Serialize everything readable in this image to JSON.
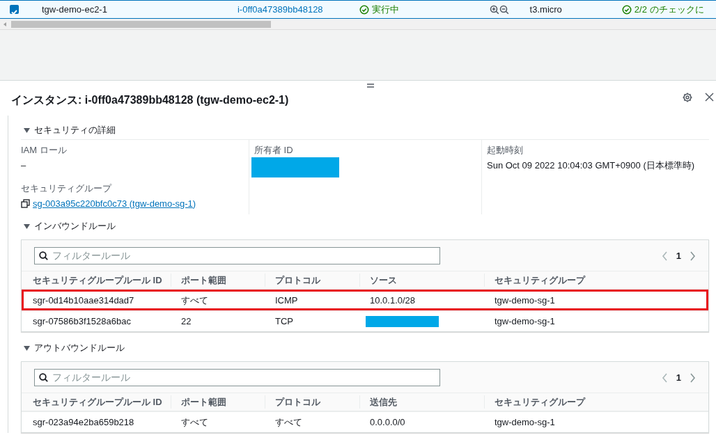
{
  "instance_row": {
    "checked": true,
    "name": "tgw-demo-ec2-1",
    "instance_id": "i-0ff0a47389bb48128",
    "state": "実行中",
    "type": "t3.micro",
    "status_check": "2/2 のチェックに"
  },
  "panel": {
    "title": "インスタンス: i-0ff0a47389bb48128 (tgw-demo-ec2-1)"
  },
  "security_details": {
    "heading": "セキュリティの詳細",
    "expanded": true,
    "fields": [
      {
        "label": "IAM ロール",
        "value": "–",
        "kind": "text"
      },
      {
        "label": "所有者 ID",
        "kind": "redacted"
      },
      {
        "label": "起動時刻",
        "value": "Sun Oct 09 2022 10:04:03 GMT+0900 (日本標準時)",
        "kind": "text"
      },
      {
        "label": "セキュリティグループ",
        "value": "sg-003a95c220bfc0c73 (tgw-demo-sg-1)",
        "kind": "link"
      }
    ]
  },
  "rule_tables": [
    {
      "heading": "インバウンドルール",
      "expanded": true,
      "filter": {
        "placeholder": "フィルタールール"
      },
      "page": "1",
      "columns": [
        "セキュリティグループルール ID",
        "ポート範囲",
        "プロトコル",
        "ソース",
        "セキュリティグループ"
      ],
      "rows": [
        {
          "highlighted": true,
          "cells": [
            {
              "kind": "text",
              "text": "sgr-0d14b10aae314dad7"
            },
            {
              "kind": "text",
              "text": "すべて"
            },
            {
              "kind": "text",
              "text": "ICMP"
            },
            {
              "kind": "text",
              "text": "10.0.1.0/28"
            },
            {
              "kind": "text",
              "text": "tgw-demo-sg-1"
            }
          ]
        },
        {
          "highlighted": false,
          "cells": [
            {
              "kind": "text",
              "text": "sgr-07586b3f1528a6bac"
            },
            {
              "kind": "text",
              "text": "22"
            },
            {
              "kind": "text",
              "text": "TCP"
            },
            {
              "kind": "redacted"
            },
            {
              "kind": "text",
              "text": "tgw-demo-sg-1"
            }
          ]
        }
      ]
    },
    {
      "heading": "アウトバウンドルール",
      "expanded": true,
      "filter": {
        "placeholder": "フィルタールール"
      },
      "page": "1",
      "columns": [
        "セキュリティグループルール ID",
        "ポート範囲",
        "プロトコル",
        "送信先",
        "セキュリティグループ"
      ],
      "rows": [
        {
          "highlighted": false,
          "cells": [
            {
              "kind": "text",
              "text": "sgr-023a94e2ba659b218"
            },
            {
              "kind": "text",
              "text": "すべて"
            },
            {
              "kind": "text",
              "text": "すべて"
            },
            {
              "kind": "text",
              "text": "0.0.0.0/0"
            },
            {
              "kind": "text",
              "text": "tgw-demo-sg-1"
            }
          ]
        }
      ]
    }
  ]
}
